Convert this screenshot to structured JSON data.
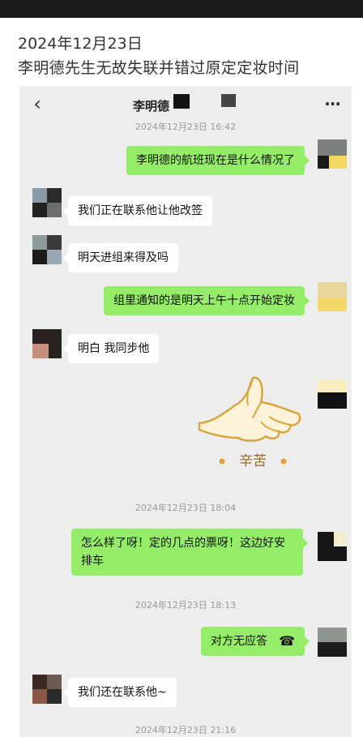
{
  "page": {
    "date": "2024年12月23日",
    "headline": "李明德先生无故失联并错过原定定妆时间"
  },
  "chat": {
    "title": "李明德",
    "back_icon": "chevron-left-icon",
    "more_icon": "more-dots-icon",
    "timestamps": [
      "2024年12月23日 16:42",
      "2024年12月23日 18:04",
      "2024年12月23日 18:13",
      "2024年12月23日 21:16"
    ],
    "messages": [
      {
        "side": "me",
        "text": "李明德的航班现在是什么情况了"
      },
      {
        "side": "them",
        "text": "我们正在联系他让他改签"
      },
      {
        "side": "them",
        "text": "明天进组来得及吗"
      },
      {
        "side": "me",
        "text": "组里通知的是明天上午十点开始定妆"
      },
      {
        "side": "them",
        "text": "明白 我同步他"
      },
      {
        "side": "me",
        "sticker": "thumbs-up-sticker",
        "text": "辛苦"
      },
      {
        "side": "me",
        "text": "怎么样了呀！定的几点的票呀！这边好安排车"
      },
      {
        "side": "me",
        "text": "对方无应答",
        "icon": "phone-hangup-icon"
      },
      {
        "side": "them",
        "text": "我们还在联系他~"
      }
    ],
    "colors": {
      "me_bubble": "#95ec69",
      "them_bubble": "#ffffff",
      "background": "#ededed"
    }
  }
}
